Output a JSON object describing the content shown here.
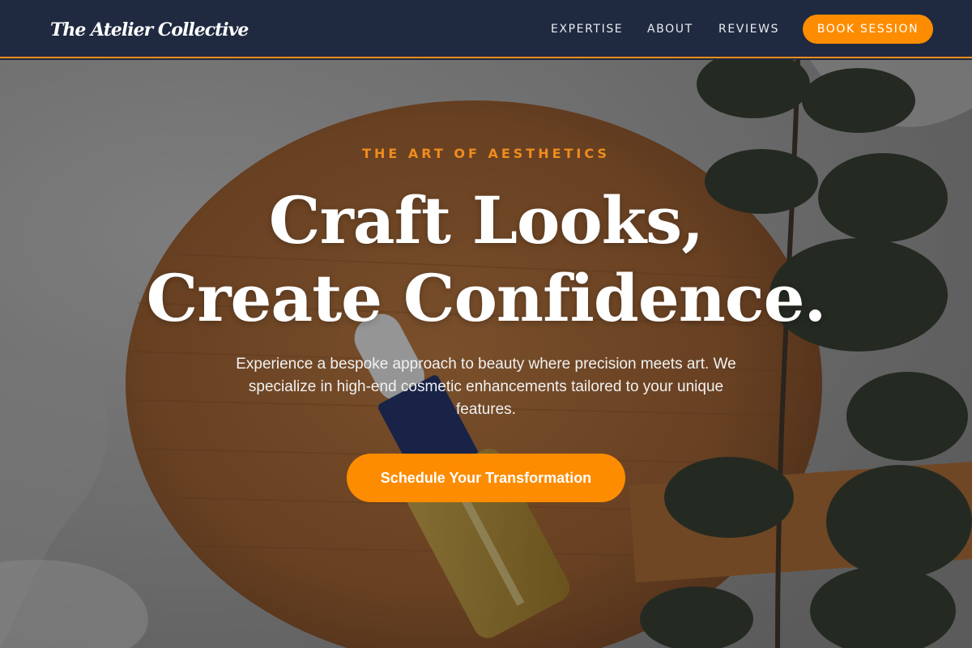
{
  "brand": {
    "name": "The Atelier Collective"
  },
  "nav": {
    "links": [
      {
        "label": "EXPERTISE"
      },
      {
        "label": "ABOUT"
      },
      {
        "label": "REVIEWS"
      }
    ],
    "cta_label": "BOOK SESSION"
  },
  "hero": {
    "eyebrow": "THE ART OF AESTHETICS",
    "headline_line1": "Craft Looks,",
    "headline_line2": "Create Confidence.",
    "subtext": "Experience a bespoke approach to beauty where precision meets art. We specialize in high-end cosmetic enhancements tailored to your unique features.",
    "cta_label": "Schedule Your Transformation",
    "background_image": "serum-bottle-on-wooden-tray-with-eucalyptus"
  },
  "colors": {
    "nav_background": "#1f2a40",
    "accent": "#fe8c00",
    "text_light": "#ffffff"
  }
}
